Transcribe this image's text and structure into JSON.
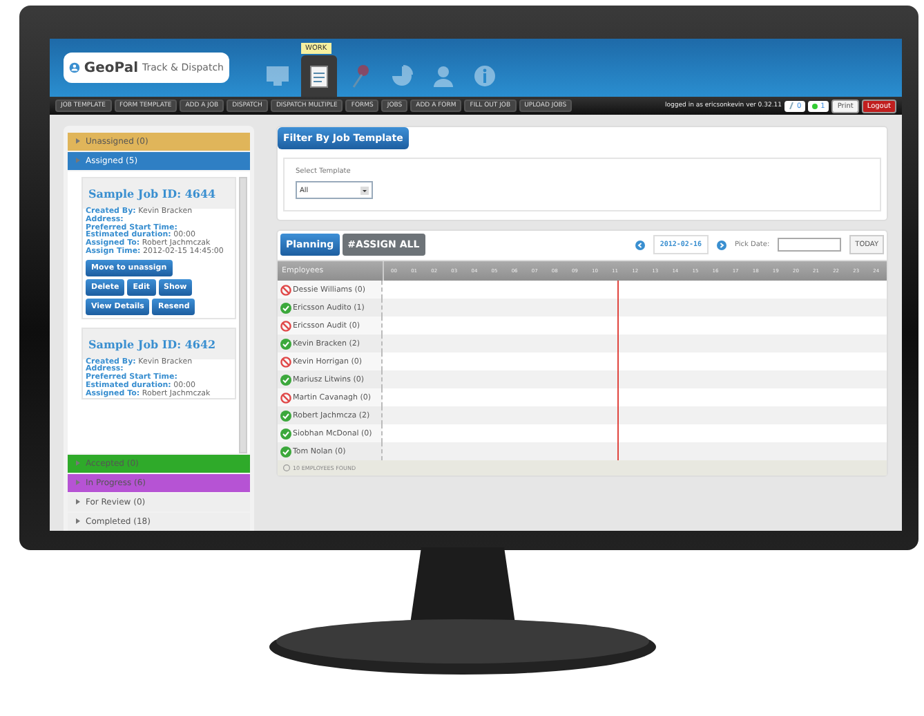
{
  "header": {
    "logo": {
      "name": "GeoPal",
      "tagline": "Track & Dispatch"
    },
    "nav_icons": [
      {
        "kind": "monitor",
        "selected": false
      },
      {
        "kind": "clipboard",
        "selected": true,
        "tooltip": "WORK"
      },
      {
        "kind": "pin",
        "selected": false
      },
      {
        "kind": "pie",
        "selected": false
      },
      {
        "kind": "person",
        "selected": false
      },
      {
        "kind": "info",
        "selected": false
      }
    ]
  },
  "menu": [
    "JOB TEMPLATE",
    "FORM TEMPLATE",
    "ADD A JOB",
    "DISPATCH",
    "DISPATCH MULTIPLE",
    "FORMS",
    "JOBS",
    "ADD A FORM",
    "FILL OUT JOB",
    "UPLOAD JOBS"
  ],
  "status": {
    "text": "logged in as ericsonkevin  ver 0.32.11",
    "counters": [
      {
        "kind": "messages",
        "count": "0"
      },
      {
        "kind": "online",
        "count": "1"
      }
    ],
    "buttons": [
      {
        "label": "Print",
        "kind": "plain"
      },
      {
        "label": "Logout",
        "kind": "danger"
      }
    ]
  },
  "sections": [
    {
      "label": "Unassigned (0)",
      "color": "#e0b55a",
      "expanded": false
    },
    {
      "label": "Assigned (5)",
      "color": "#2f7fc4",
      "expanded": true,
      "jobs": [
        {
          "title": "Sample Job ID: 4644",
          "fields": [
            {
              "label": "Created By:",
              "value": "Kevin Bracken"
            },
            {
              "label": "Address:"
            },
            {
              "label": "Preferred Start Time:"
            },
            {
              "label": "Estimated duration:",
              "value": "00:00"
            },
            {
              "label": "Assigned To:",
              "value": "Robert Jachmczak"
            },
            {
              "label": "Assign Time:",
              "value": "2012-02-15 14:45:00"
            }
          ],
          "buttons": [
            "Move to unassign",
            "Delete",
            "Edit",
            "Show",
            "View Details",
            "Resend"
          ]
        },
        {
          "title": "Sample Job ID: 4642",
          "fields": [
            {
              "label": "Created By:",
              "value": "Kevin Bracken"
            },
            {
              "label": "Address:"
            },
            {
              "label": "Preferred Start Time:"
            },
            {
              "label": "Estimated duration:",
              "value": "00:00"
            },
            {
              "label": "Assigned To:",
              "value": "Robert Jachmczak"
            }
          ]
        }
      ]
    },
    {
      "label": "Accepted (0)",
      "color": "#2faa2a",
      "expanded": false
    },
    {
      "label": "In Progress (6)",
      "color": "#b653d4",
      "expanded": false
    },
    {
      "label": "For Review (0)",
      "color": "#eeeeee",
      "expanded": false
    },
    {
      "label": "Completed (18)",
      "color": "#eeeeee",
      "expanded": false
    }
  ],
  "filter": {
    "title": "Filter By Job Template",
    "select_label": "Select Template",
    "value": "All"
  },
  "planning": {
    "tabs": [
      {
        "label": "Planning",
        "selected": true
      },
      {
        "label": "#ASSIGN ALL",
        "selected": false
      }
    ],
    "date": "2012-02-16",
    "pick_date_label": "Pick Date:",
    "today": "TODAY",
    "columns": {
      "employees": "Employees",
      "hours": [
        "00",
        "01",
        "02",
        "03",
        "04",
        "05",
        "06",
        "07",
        "08",
        "09",
        "10",
        "11",
        "12",
        "13",
        "14",
        "15",
        "16",
        "17",
        "18",
        "19",
        "20",
        "21",
        "22",
        "23",
        "24"
      ]
    },
    "rows": [
      {
        "name": "Dessie Williams (0)",
        "available": false
      },
      {
        "name": "Ericsson Audito (1)",
        "available": true
      },
      {
        "name": "Ericsson Audit (0)",
        "available": false
      },
      {
        "name": "Kevin Bracken (2)",
        "available": true
      },
      {
        "name": "Kevin Horrigan (0)",
        "available": false
      },
      {
        "name": "Mariusz Litwins (0)",
        "available": true
      },
      {
        "name": "Martin Cavanagh (0)",
        "available": false
      },
      {
        "name": "Robert Jachmcza (2)",
        "available": true
      },
      {
        "name": "Siobhan McDonal (0)",
        "available": true
      },
      {
        "name": "Tom Nolan (0)",
        "available": true
      }
    ],
    "footer": "10 EMPLOYEES FOUND"
  }
}
